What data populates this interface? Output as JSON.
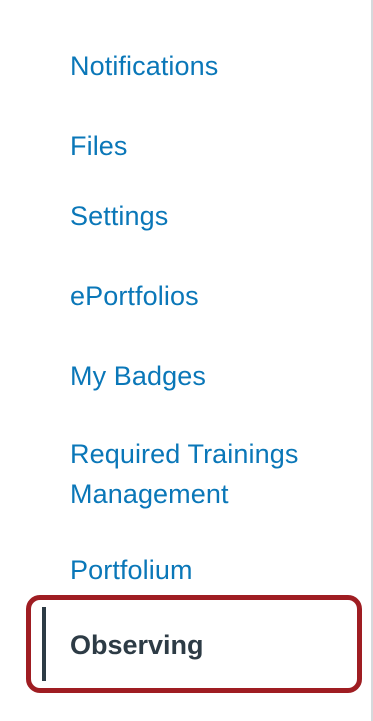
{
  "account_nav": {
    "items": [
      {
        "label": "Notifications"
      },
      {
        "label": "Files"
      },
      {
        "label": "Settings"
      },
      {
        "label": "ePortfolios"
      },
      {
        "label": "My Badges"
      },
      {
        "label_line1": "Required Trainings",
        "label_line2": "Management"
      },
      {
        "label": "Portfolium"
      }
    ],
    "active_item": {
      "label": "Observing"
    }
  },
  "colors": {
    "link": "#0a77b8",
    "active_text": "#2d3b45",
    "highlight_border": "#9f1d22",
    "panel_border": "#d6d9dc"
  }
}
